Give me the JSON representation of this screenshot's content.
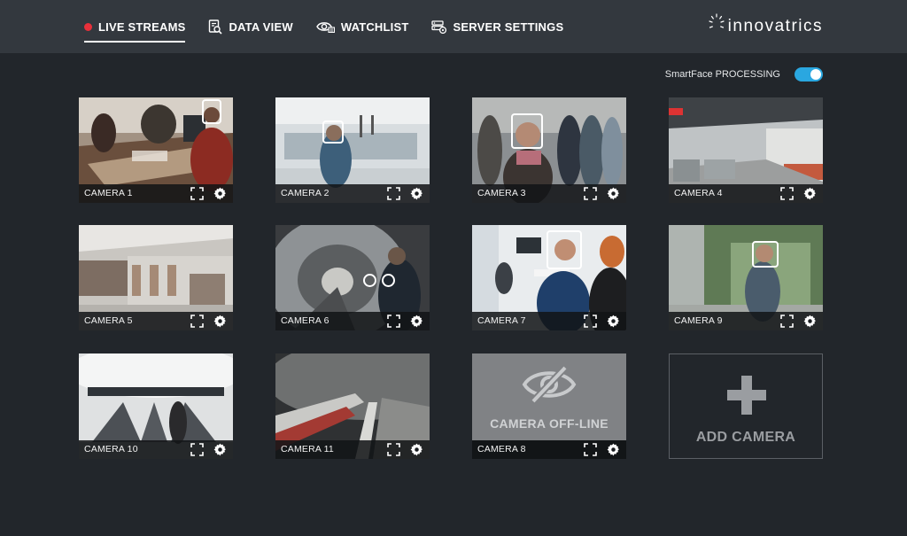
{
  "nav": {
    "items": [
      {
        "label": "LIVE STREAMS",
        "icon": "live-dot-icon",
        "active": true
      },
      {
        "label": "DATA VIEW",
        "icon": "document-search-icon",
        "active": false
      },
      {
        "label": "WATCHLIST",
        "icon": "eye-list-icon",
        "active": false
      },
      {
        "label": "SERVER SETTINGS",
        "icon": "server-gear-icon",
        "active": false
      }
    ]
  },
  "brand": {
    "name": "innovatrics",
    "accent": "#2aa7e0",
    "live_color": "#e8303a"
  },
  "processing": {
    "label": "SmartFace PROCESSING",
    "enabled": true
  },
  "cameras": [
    {
      "label": "CAMERA 1",
      "status": "online"
    },
    {
      "label": "CAMERA 2",
      "status": "online"
    },
    {
      "label": "CAMERA 3",
      "status": "online"
    },
    {
      "label": "CAMERA 4",
      "status": "online"
    },
    {
      "label": "CAMERA 5",
      "status": "online"
    },
    {
      "label": "CAMERA 6",
      "status": "online"
    },
    {
      "label": "CAMERA 7",
      "status": "online"
    },
    {
      "label": "CAMERA 9",
      "status": "online"
    },
    {
      "label": "CAMERA 10",
      "status": "online"
    },
    {
      "label": "CAMERA 11",
      "status": "online"
    },
    {
      "label": "CAMERA 8",
      "status": "offline",
      "offline_text": "CAMERA OFF-LINE"
    }
  ],
  "add_camera": {
    "label": "ADD CAMERA"
  }
}
